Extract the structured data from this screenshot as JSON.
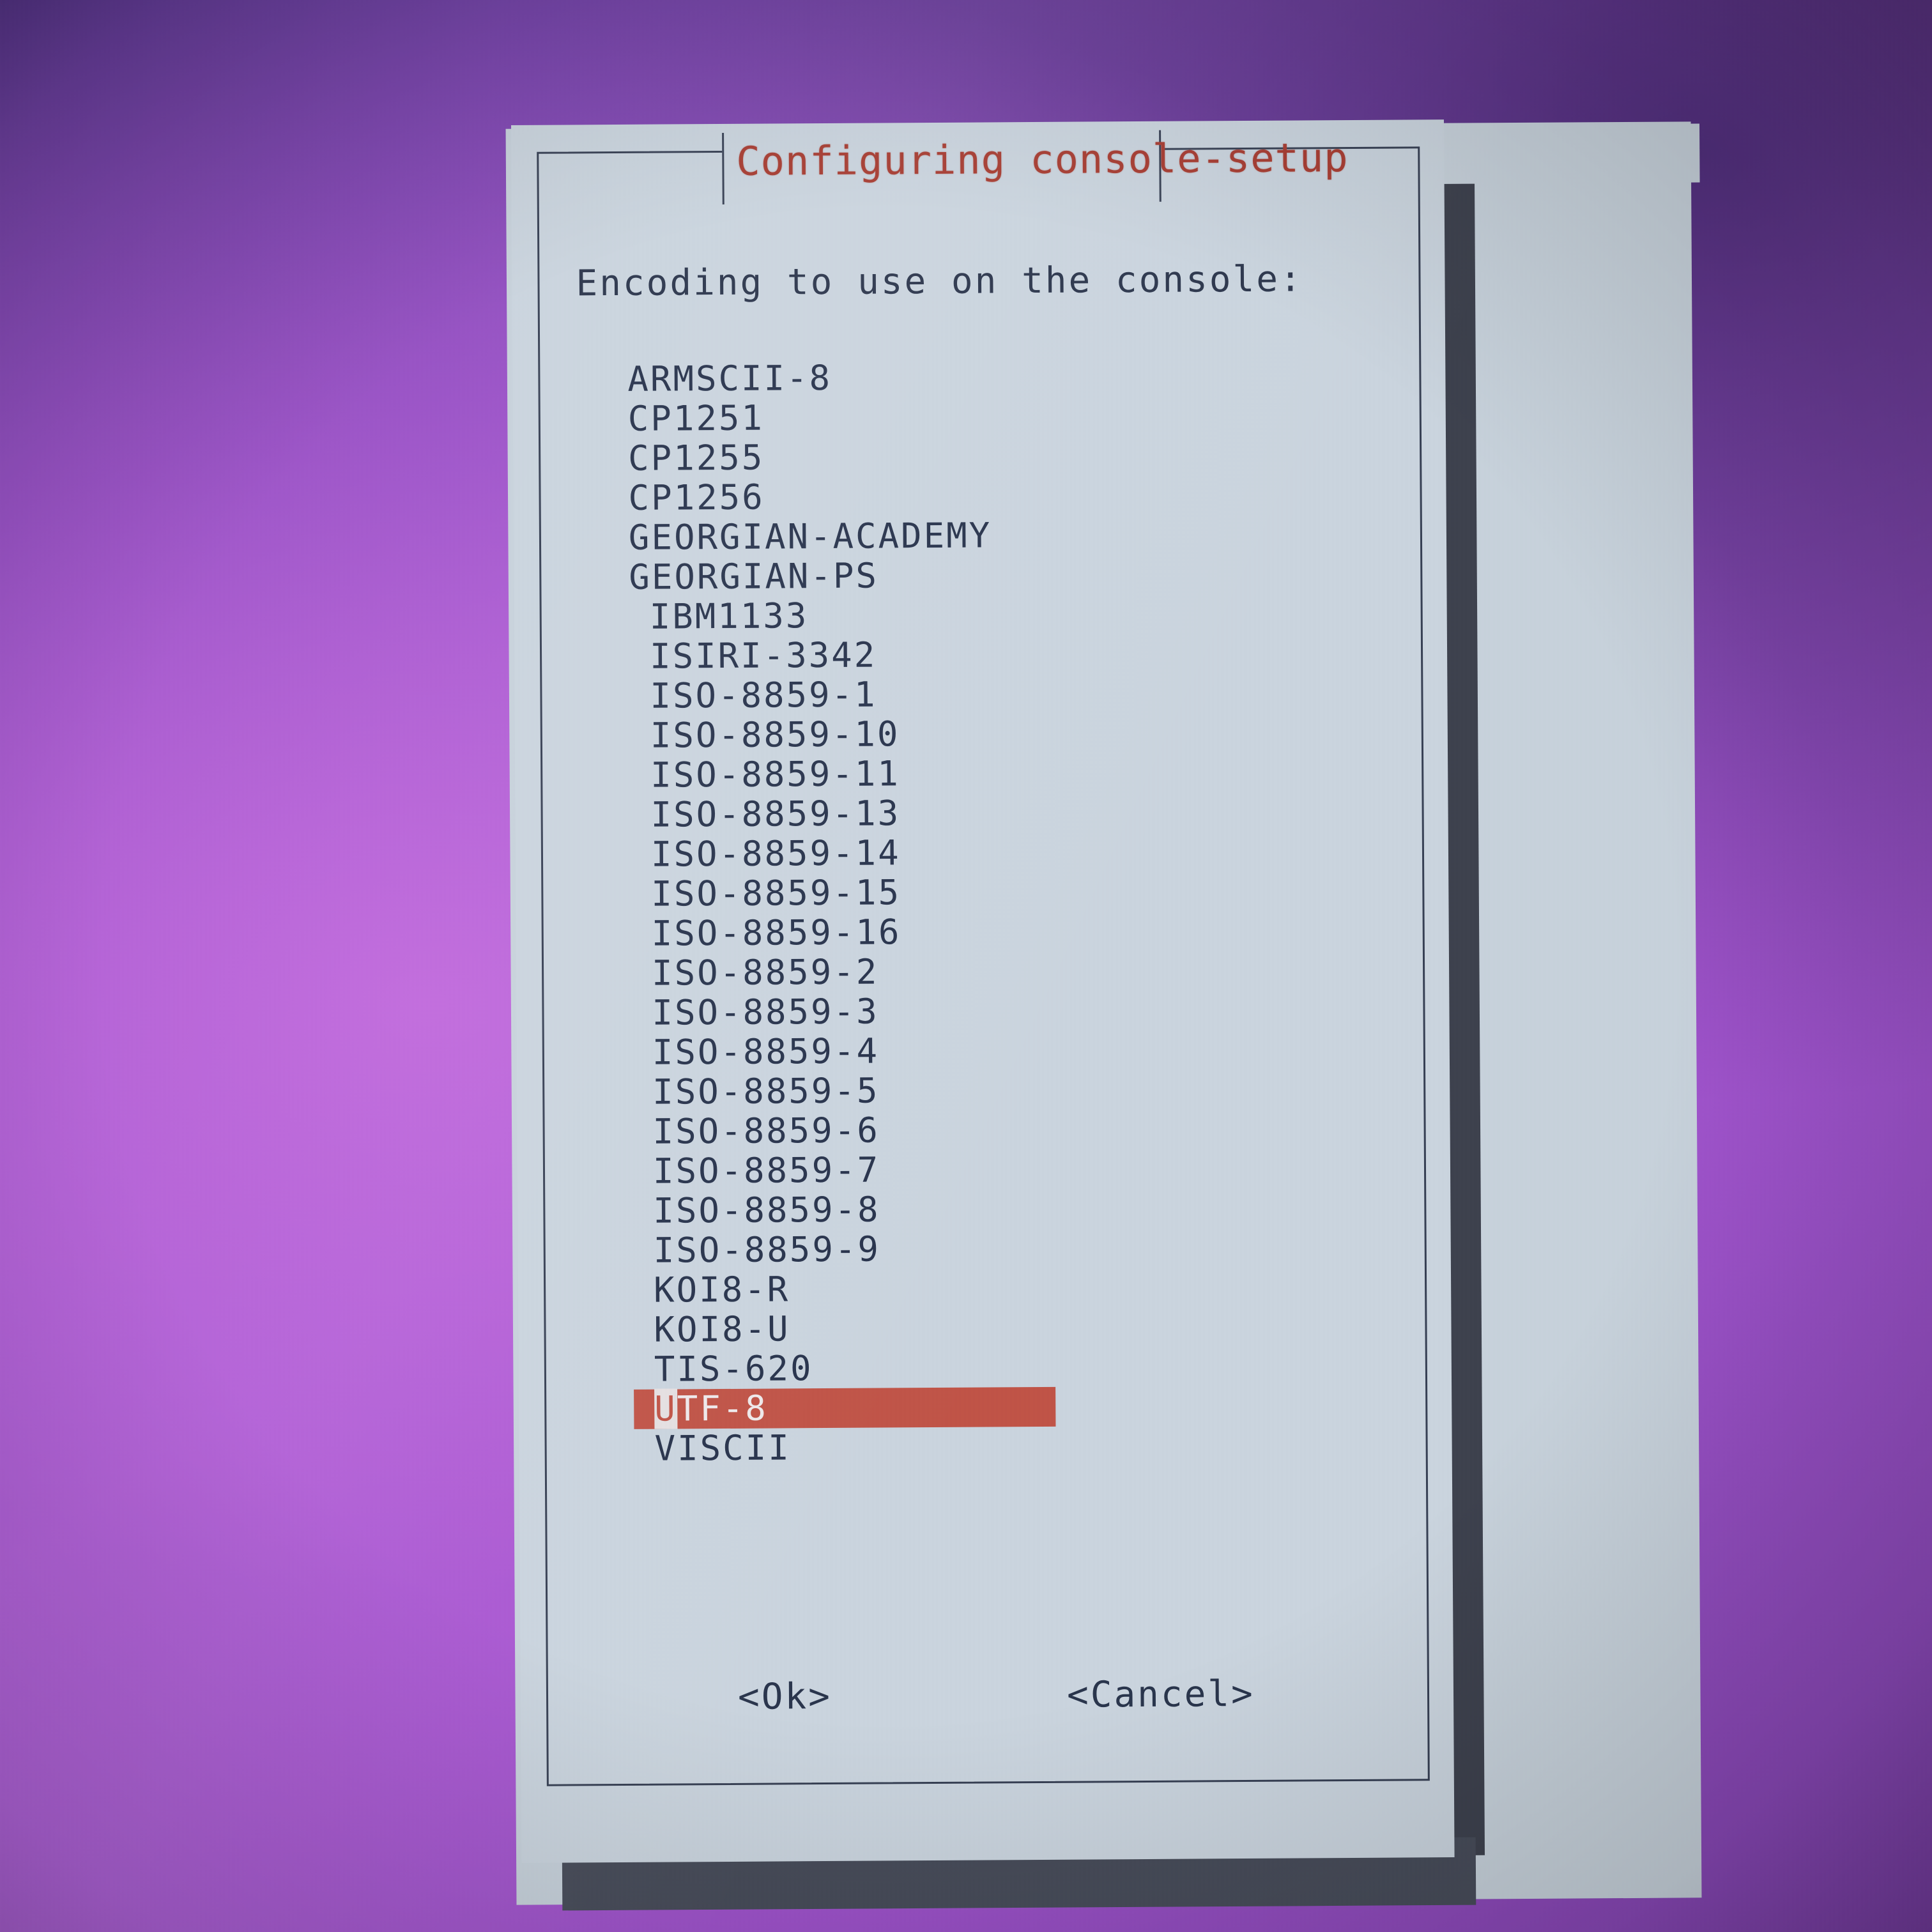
{
  "window": {
    "title": "Configuring console-setup",
    "title_color": "#a8392e",
    "panel_color": "#ccd7e1",
    "text_color": "#24304a",
    "desktop_color": "#a453d2"
  },
  "dialog": {
    "prompt": "Encoding to use on the console:",
    "highlight_color": "#c25245",
    "highlight_text_color": "#f2ecee",
    "selected_value": "UTF-8",
    "encodings": [
      {
        "label": "ARMSCII-8",
        "indent": false,
        "selected": false
      },
      {
        "label": "CP1251",
        "indent": false,
        "selected": false
      },
      {
        "label": "CP1255",
        "indent": false,
        "selected": false
      },
      {
        "label": "CP1256",
        "indent": false,
        "selected": false
      },
      {
        "label": "GEORGIAN-ACADEMY",
        "indent": false,
        "selected": false
      },
      {
        "label": "GEORGIAN-PS",
        "indent": false,
        "selected": false
      },
      {
        "label": "IBM1133",
        "indent": true,
        "selected": false
      },
      {
        "label": "ISIRI-3342",
        "indent": true,
        "selected": false
      },
      {
        "label": "ISO-8859-1",
        "indent": true,
        "selected": false
      },
      {
        "label": "ISO-8859-10",
        "indent": true,
        "selected": false
      },
      {
        "label": "ISO-8859-11",
        "indent": true,
        "selected": false
      },
      {
        "label": "ISO-8859-13",
        "indent": true,
        "selected": false
      },
      {
        "label": "ISO-8859-14",
        "indent": true,
        "selected": false
      },
      {
        "label": "ISO-8859-15",
        "indent": true,
        "selected": false
      },
      {
        "label": "ISO-8859-16",
        "indent": true,
        "selected": false
      },
      {
        "label": "ISO-8859-2",
        "indent": true,
        "selected": false
      },
      {
        "label": "ISO-8859-3",
        "indent": true,
        "selected": false
      },
      {
        "label": "ISO-8859-4",
        "indent": true,
        "selected": false
      },
      {
        "label": "ISO-8859-5",
        "indent": true,
        "selected": false
      },
      {
        "label": "ISO-8859-6",
        "indent": true,
        "selected": false
      },
      {
        "label": "ISO-8859-7",
        "indent": true,
        "selected": false
      },
      {
        "label": "ISO-8859-8",
        "indent": true,
        "selected": false
      },
      {
        "label": "ISO-8859-9",
        "indent": true,
        "selected": false
      },
      {
        "label": "KOI8-R",
        "indent": true,
        "selected": false
      },
      {
        "label": "KOI8-U",
        "indent": true,
        "selected": false
      },
      {
        "label": "TIS-620",
        "indent": true,
        "selected": false
      },
      {
        "label": "UTF-8",
        "indent": true,
        "selected": true
      },
      {
        "label": "VISCII",
        "indent": true,
        "selected": false
      }
    ],
    "buttons": {
      "ok": "<Ok>",
      "cancel": "<Cancel>"
    }
  }
}
